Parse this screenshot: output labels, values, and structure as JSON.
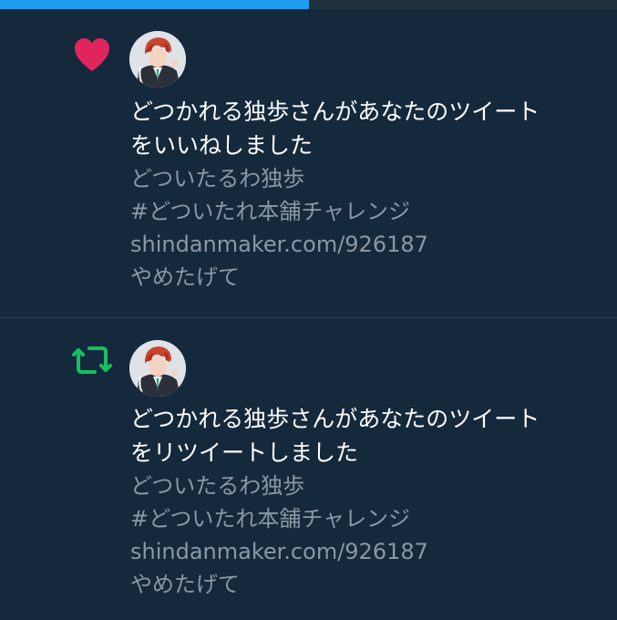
{
  "progress": {
    "fill_fraction": 0.5
  },
  "colors": {
    "background": "#15293d",
    "like": "#e0245e",
    "retweet": "#17bf63",
    "primary_text": "#ffffff",
    "secondary_text": "#8b98a5",
    "progress": "#1f9bf0"
  },
  "notifications": [
    {
      "type": "like",
      "icon": "heart-icon",
      "headline_line1": "どつかれる独歩さんがあなたのツイート",
      "headline_line2": "をいいねしました",
      "tweet_lines": [
        "どついたるわ独歩",
        "#どついたれ本舗チャレンジ",
        "shindanmaker.com/926187",
        "やめたげて"
      ]
    },
    {
      "type": "retweet",
      "icon": "retweet-icon",
      "headline_line1": "どつかれる独歩さんがあなたのツイート",
      "headline_line2": "をリツイートしました",
      "tweet_lines": [
        "どついたるわ独歩",
        "#どついたれ本舗チャレンジ",
        "shindanmaker.com/926187",
        "やめたげて"
      ]
    }
  ]
}
